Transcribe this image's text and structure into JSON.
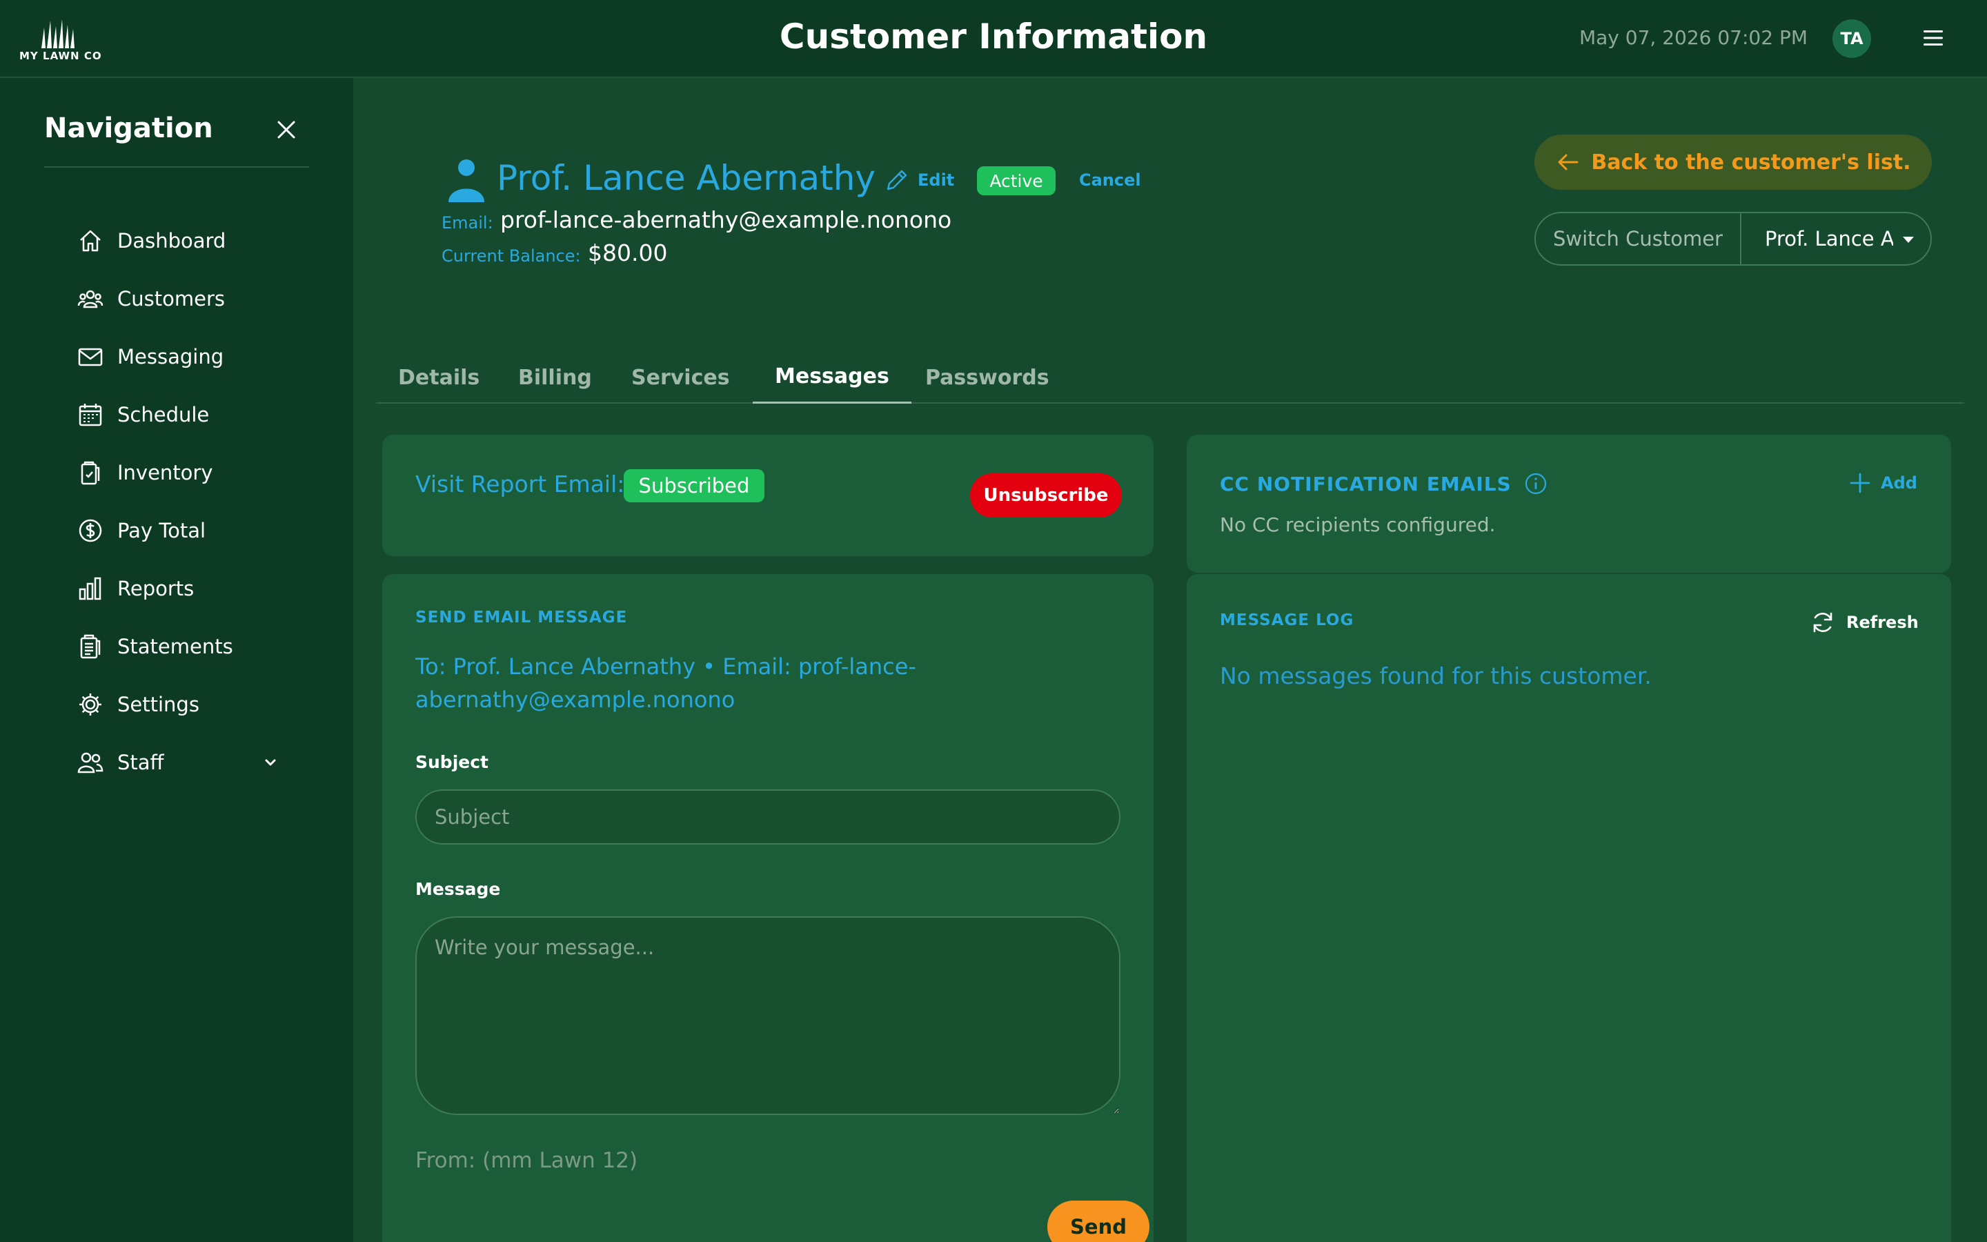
{
  "header": {
    "logo_text": "MY LAWN CO",
    "title": "Customer Information",
    "datetime": "May 07, 2026 07:02 PM",
    "avatar_initials": "TA"
  },
  "sidebar": {
    "title": "Navigation",
    "items": [
      {
        "label": "Dashboard",
        "icon": "home-icon"
      },
      {
        "label": "Customers",
        "icon": "users-icon"
      },
      {
        "label": "Messaging",
        "icon": "mail-icon"
      },
      {
        "label": "Schedule",
        "icon": "calendar-icon"
      },
      {
        "label": "Inventory",
        "icon": "clipboard-check-icon"
      },
      {
        "label": "Pay Total",
        "icon": "dollar-circle-icon"
      },
      {
        "label": "Reports",
        "icon": "bar-chart-icon"
      },
      {
        "label": "Statements",
        "icon": "document-list-icon"
      },
      {
        "label": "Settings",
        "icon": "gear-icon"
      },
      {
        "label": "Staff",
        "icon": "staff-icon"
      }
    ]
  },
  "customer": {
    "name": "Prof. Lance Abernathy",
    "edit_label": "Edit",
    "status": "Active",
    "cancel_label": "Cancel",
    "email_label": "Email:",
    "email": "prof-lance-abernathy@example.nonono",
    "balance_label": "Current Balance:",
    "balance": "$80.00"
  },
  "actions": {
    "back_label": "Back to the customer's list.",
    "switch_label": "Switch Customer",
    "switch_value": "Prof. Lance Abernathy"
  },
  "tabs": [
    {
      "label": "Details",
      "active": false
    },
    {
      "label": "Billing",
      "active": false
    },
    {
      "label": "Services",
      "active": false
    },
    {
      "label": "Messages",
      "active": true
    },
    {
      "label": "Passwords",
      "active": false
    }
  ],
  "visit_report": {
    "label": "Visit Report Email:",
    "status": "Subscribed",
    "unsubscribe_label": "Unsubscribe"
  },
  "send_email": {
    "heading": "SEND EMAIL MESSAGE",
    "to_line": "To: Prof. Lance Abernathy • Email: prof-lance-abernathy@example.nonono",
    "subject_label": "Subject",
    "subject_placeholder": "Subject",
    "message_label": "Message",
    "message_placeholder": "Write your message...",
    "from_line": "From: (mm Lawn 12)",
    "send_label": "Send"
  },
  "cc": {
    "heading": "CC NOTIFICATION EMAILS",
    "add_label": "Add",
    "empty_text": "No CC recipients configured."
  },
  "message_log": {
    "heading": "MESSAGE LOG",
    "refresh_label": "Refresh",
    "empty_text": "No messages found for this customer."
  },
  "colors": {
    "background": "#154a2e",
    "sidebar": "#0d3a23",
    "card": "#1b5d38",
    "accent_blue": "#2aa8e0",
    "accent_orange": "#f7931e",
    "success_green": "#1fbf5c",
    "danger_red": "#e3000f"
  }
}
